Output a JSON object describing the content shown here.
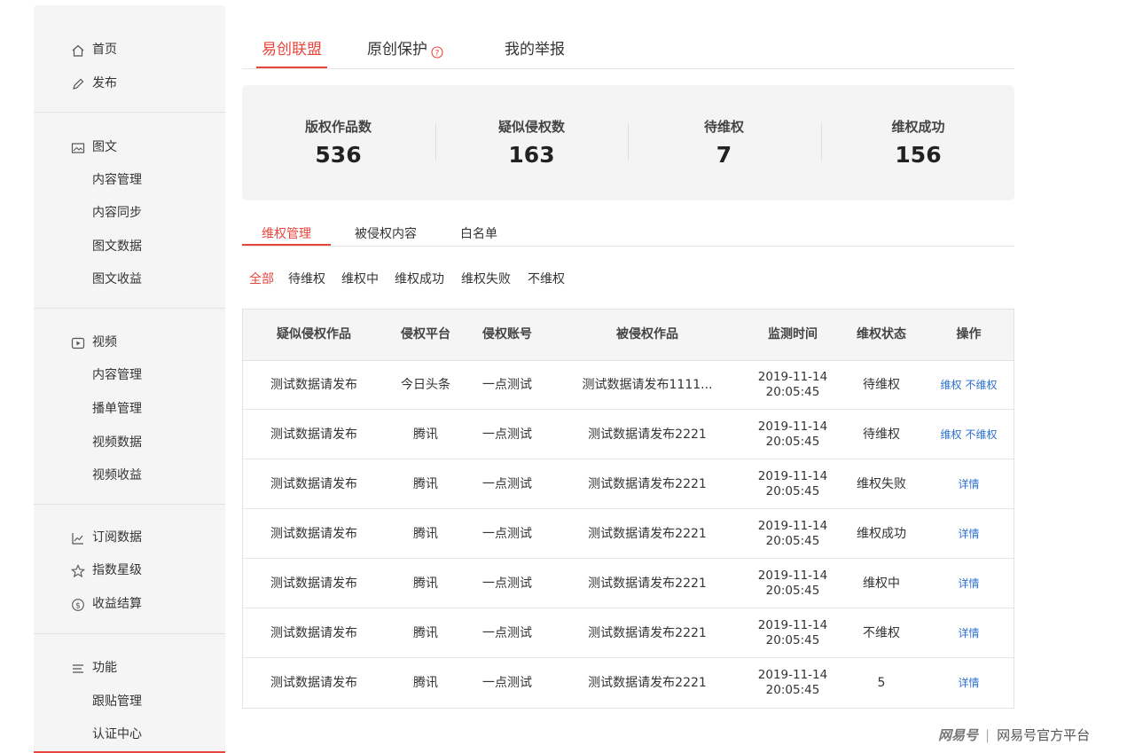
{
  "sidebar": {
    "items": [
      {
        "label": "首页",
        "icon": "home-icon"
      },
      {
        "label": "发布",
        "icon": "pencil-icon"
      },
      {
        "label": "图文",
        "icon": "image-icon"
      },
      {
        "label": "内容管理"
      },
      {
        "label": "内容同步"
      },
      {
        "label": "图文数据"
      },
      {
        "label": "图文收益"
      },
      {
        "label": "视频",
        "icon": "play-icon"
      },
      {
        "label": "内容管理"
      },
      {
        "label": "播单管理"
      },
      {
        "label": "视频数据"
      },
      {
        "label": "视频收益"
      },
      {
        "label": "订阅数据",
        "icon": "line-chart-icon"
      },
      {
        "label": "指数星级",
        "icon": "star-icon"
      },
      {
        "label": "收益结算",
        "icon": "dollar-circle-icon"
      },
      {
        "label": "功能",
        "icon": "menu-icon"
      },
      {
        "label": "跟贴管理"
      },
      {
        "label": "认证中心"
      }
    ]
  },
  "top_tabs": [
    {
      "label": "易创联盟"
    },
    {
      "label": "原创保护"
    },
    {
      "label": "我的举报"
    }
  ],
  "stats": [
    {
      "title": "版权作品数",
      "value": "536"
    },
    {
      "title": "疑似侵权数",
      "value": "163"
    },
    {
      "title": "待维权",
      "value": "7"
    },
    {
      "title": "维权成功",
      "value": "156"
    }
  ],
  "sub_tabs": [
    {
      "label": "维权管理"
    },
    {
      "label": "被侵权内容"
    },
    {
      "label": "白名单"
    }
  ],
  "filters": [
    {
      "label": "全部"
    },
    {
      "label": "待维权"
    },
    {
      "label": "维权中"
    },
    {
      "label": "维权成功"
    },
    {
      "label": "维权失败"
    },
    {
      "label": "不维权"
    }
  ],
  "table": {
    "headers": [
      "疑似侵权作品",
      "侵权平台",
      "侵权账号",
      "被侵权作品",
      "监测时间",
      "维权状态",
      "操作"
    ],
    "rows": [
      {
        "work": "测试数据请发布",
        "platform": "今日头条",
        "account": "一点测试",
        "original": "测试数据请发布1111...",
        "date": "2019-11-14",
        "time": "20:05:45",
        "status": "待维权",
        "ops": [
          "维权",
          "不维权"
        ]
      },
      {
        "work": "测试数据请发布",
        "platform": "腾讯",
        "account": "一点测试",
        "original": "测试数据请发布2221",
        "date": "2019-11-14",
        "time": "20:05:45",
        "status": "待维权",
        "ops": [
          "维权",
          "不维权"
        ]
      },
      {
        "work": "测试数据请发布",
        "platform": "腾讯",
        "account": "一点测试",
        "original": "测试数据请发布2221",
        "date": "2019-11-14",
        "time": "20:05:45",
        "status": "维权失败",
        "ops": [
          "详情"
        ]
      },
      {
        "work": "测试数据请发布",
        "platform": "腾讯",
        "account": "一点测试",
        "original": "测试数据请发布2221",
        "date": "2019-11-14",
        "time": "20:05:45",
        "status": "维权成功",
        "ops": [
          "详情"
        ]
      },
      {
        "work": "测试数据请发布",
        "platform": "腾讯",
        "account": "一点测试",
        "original": "测试数据请发布2221",
        "date": "2019-11-14",
        "time": "20:05:45",
        "status": "维权中",
        "ops": [
          "详情"
        ]
      },
      {
        "work": "测试数据请发布",
        "platform": "腾讯",
        "account": "一点测试",
        "original": "测试数据请发布2221",
        "date": "2019-11-14",
        "time": "20:05:45",
        "status": "不维权",
        "ops": [
          "详情"
        ]
      },
      {
        "work": "测试数据请发布",
        "platform": "腾讯",
        "account": "一点测试",
        "original": "测试数据请发布2221",
        "date": "2019-11-14",
        "time": "20:05:45",
        "status": "5",
        "ops": [
          "详情"
        ]
      }
    ]
  },
  "watermark": {
    "brand": "网易号",
    "separator": "|",
    "text": "网易号官方平台"
  },
  "colors": {
    "accent": "#e8453c",
    "link": "#2c6fd1",
    "panel": "#f4f4f4"
  }
}
